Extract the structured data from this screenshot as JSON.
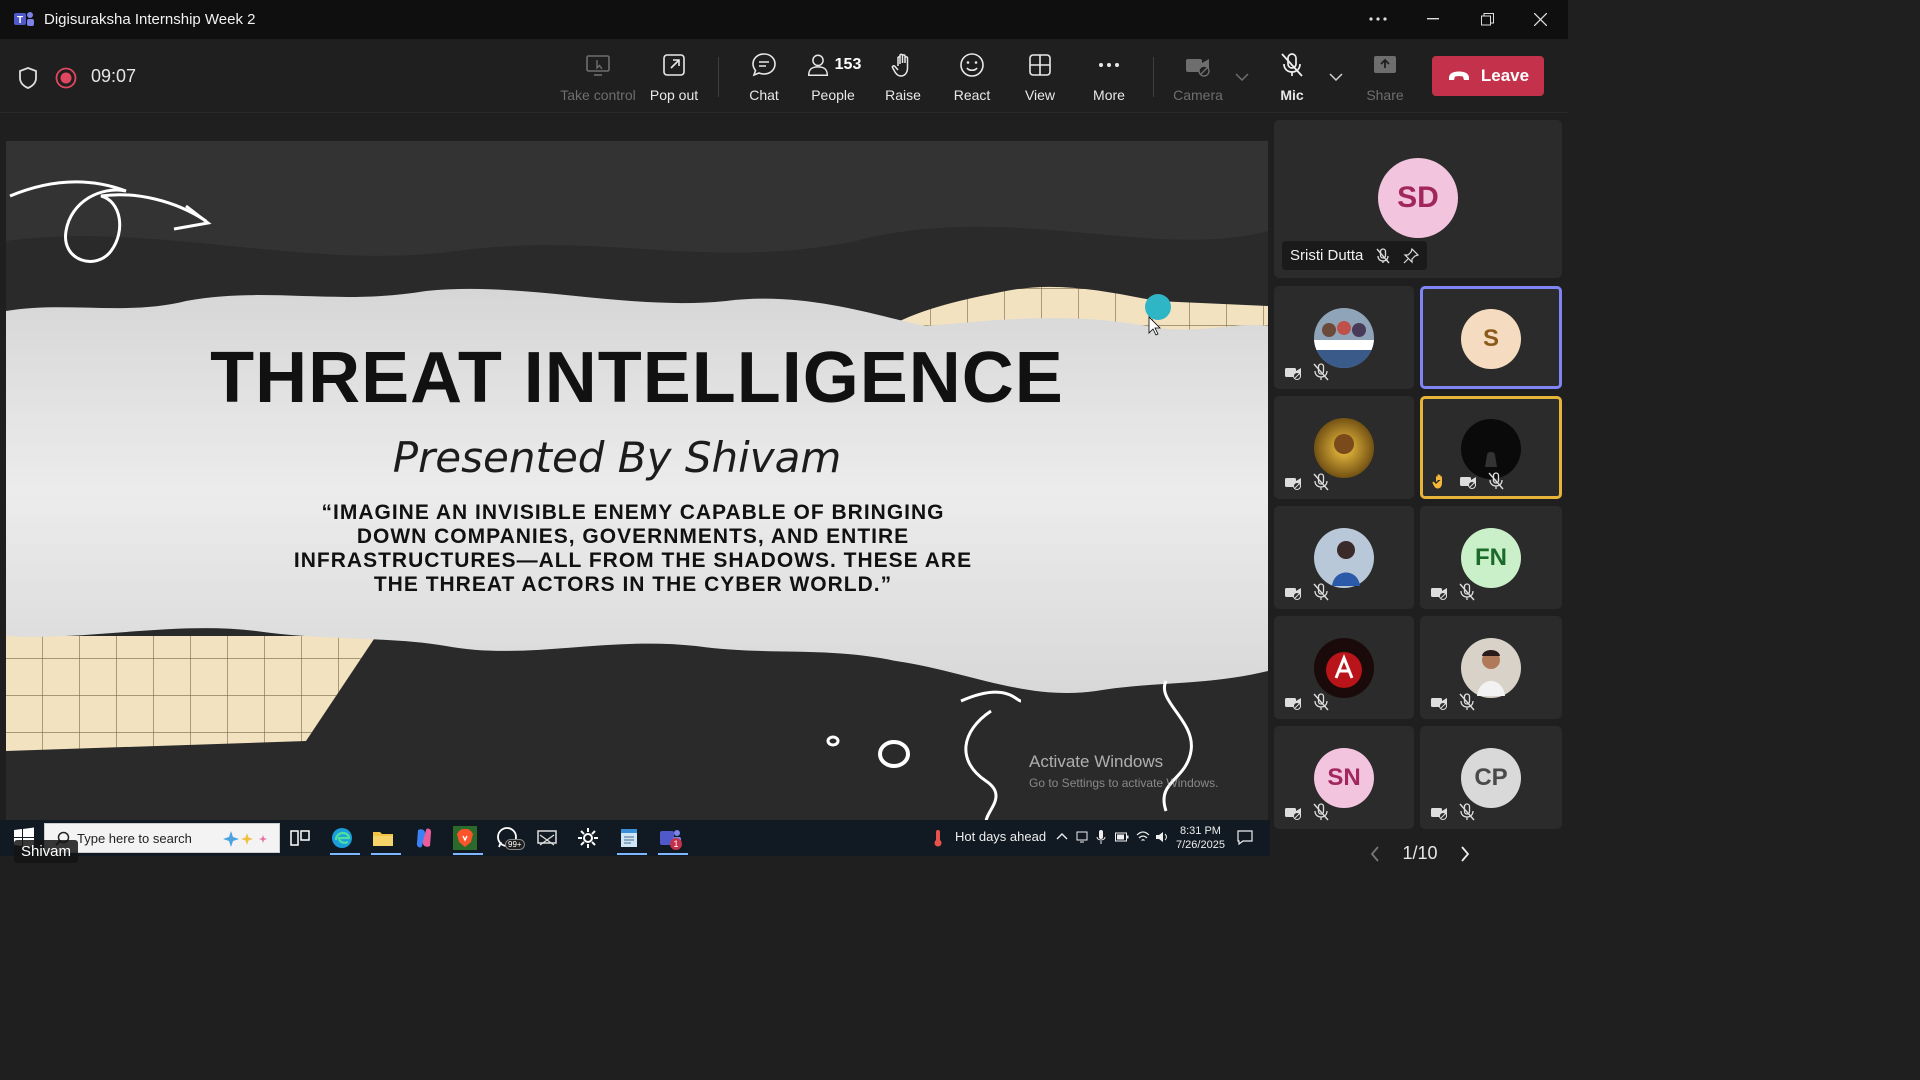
{
  "window": {
    "title": "Digisuraksha Internship Week 2",
    "minimize": "—",
    "close": "✕"
  },
  "meeting": {
    "timer": "09:07"
  },
  "toolbar": {
    "take_control": "Take control",
    "pop_out": "Pop out",
    "chat": "Chat",
    "people": "People",
    "people_count": "153",
    "raise": "Raise",
    "react": "React",
    "view": "View",
    "more": "More",
    "camera": "Camera",
    "mic": "Mic",
    "share": "Share",
    "leave": "Leave"
  },
  "slide": {
    "title": "THREAT INTELLIGENCE",
    "subtitle": "Presented By Shivam",
    "quote_line1": "“IMAGINE AN INVISIBLE ENEMY CAPABLE OF BRINGING",
    "quote_line2": "DOWN COMPANIES, GOVERNMENTS, AND ENTIRE",
    "quote_line3": "INFRASTRUCTURES—ALL FROM THE SHADOWS. THESE ARE",
    "quote_line4": "THE THREAT ACTORS IN THE CYBER WORLD.”",
    "watermark_title": "Activate Windows",
    "watermark_sub": "Go to Settings to activate Windows."
  },
  "taskbar": {
    "search_placeholder": "Type here to search",
    "weather": "Hot days ahead",
    "time": "8:31 PM",
    "date": "7/26/2025",
    "whatsapp_badge": "99+",
    "teams_badge": "1"
  },
  "presenter_tag": "Shivam",
  "participants": {
    "featured": {
      "initials": "SD",
      "name": "Sristi Dutta",
      "avatar_color": "#f2c4dd"
    },
    "tiles": [
      {
        "initials": "",
        "kind": "photo-group"
      },
      {
        "initials": "S",
        "avatar_color": "#f5dcc0",
        "state": "active"
      },
      {
        "initials": "",
        "kind": "photo-gold"
      },
      {
        "initials": "",
        "kind": "photo-dark",
        "state": "hand-raised"
      },
      {
        "initials": "",
        "kind": "photo-person"
      },
      {
        "initials": "FN",
        "avatar_color": "#c9f0c9"
      },
      {
        "initials": "",
        "kind": "photo-red"
      },
      {
        "initials": "",
        "kind": "photo-man"
      },
      {
        "initials": "SN",
        "avatar_color": "#f2c4dd"
      },
      {
        "initials": "CP",
        "avatar_color": "#d9d9d9"
      }
    ]
  },
  "pager": {
    "label": "1/10"
  }
}
